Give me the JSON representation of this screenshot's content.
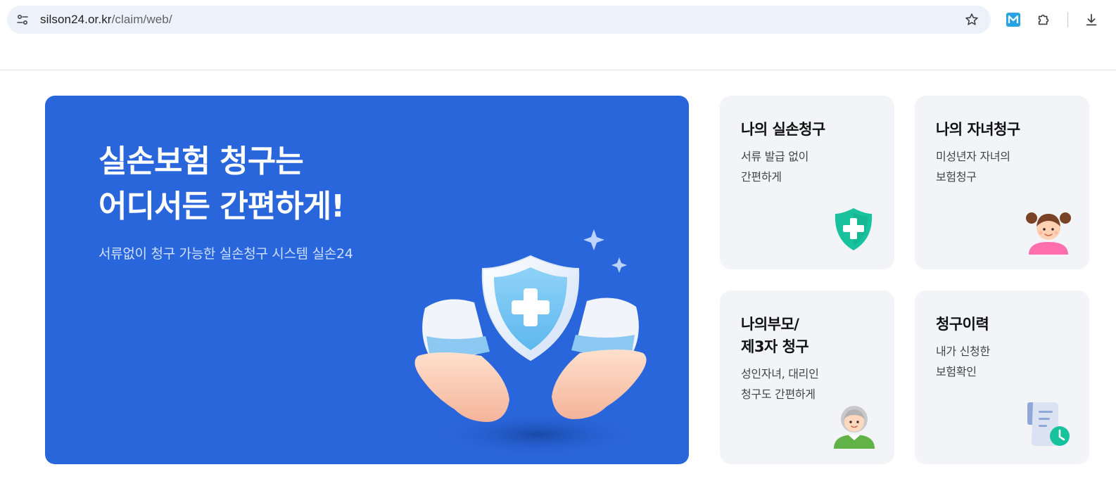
{
  "browser": {
    "url_host": "silson24.or.kr",
    "url_path": "/claim/web/",
    "icons": [
      "site-info-icon",
      "bookmark-star-icon",
      "extension-m-icon",
      "extensions-puzzle-icon",
      "download-icon"
    ],
    "accent": "#1a73e8"
  },
  "hero": {
    "title_line1": "실손보험 청구는",
    "title_line2": "어디서든 간편하게!",
    "subtitle": "서류없이 청구 가능한 실손청구 시스템 실손24",
    "background": "#2a66db"
  },
  "cards": [
    {
      "title": "나의 실손청구",
      "desc_line1": "서류 발급 없이",
      "desc_line2": "간편하게",
      "icon": "medical-shield-icon"
    },
    {
      "title": "나의 자녀청구",
      "desc_line1": "미성년자 자녀의",
      "desc_line2": "보험청구",
      "icon": "child-avatar-icon"
    },
    {
      "title_line1": "나의부모/",
      "title_line2": "제3자 청구",
      "desc_line1": "성인자녀, 대리인",
      "desc_line2": "청구도 간편하게",
      "icon": "elderly-avatar-icon"
    },
    {
      "title": "청구이력",
      "desc_line1": "내가 신청한",
      "desc_line2": "보험확인",
      "icon": "document-clock-icon"
    }
  ]
}
